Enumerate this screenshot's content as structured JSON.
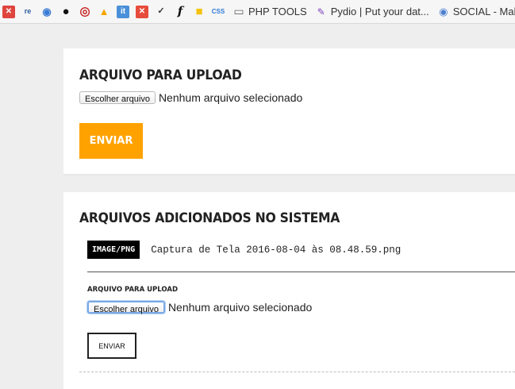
{
  "bookmarks": {
    "icons": [
      {
        "name": "red-checker-icon",
        "glyph": "✕",
        "color": "#e0443e"
      },
      {
        "name": "regex101-icon",
        "glyph": "re",
        "color": "#2b5c9e"
      },
      {
        "name": "database-icon",
        "glyph": "◉",
        "color": "#3a7bd5"
      },
      {
        "name": "github-icon",
        "glyph": "●",
        "color": "#111111"
      },
      {
        "name": "opera-icon",
        "glyph": "◎",
        "color": "#c62828"
      },
      {
        "name": "firebase-icon",
        "glyph": "▲",
        "color": "#f6a500"
      },
      {
        "name": "it-icon",
        "glyph": "it",
        "color": "#4a90d9"
      },
      {
        "name": "laravel-icon",
        "glyph": "✕",
        "color": "#e74c3c"
      },
      {
        "name": "json-icon",
        "glyph": "✓",
        "color": "#333333"
      },
      {
        "name": "function-icon",
        "glyph": "f",
        "color": "#111111"
      },
      {
        "name": "box-icon",
        "glyph": "■",
        "color": "#f4c20d"
      },
      {
        "name": "css-icon",
        "glyph": "CSS",
        "color": "#2d7ad6"
      }
    ],
    "items": [
      {
        "name": "folder-icon",
        "glyph": "▭",
        "label": "PHP TOOLS"
      },
      {
        "name": "pydio-icon",
        "glyph": "✎",
        "label": "Pydio | Put your dat..."
      },
      {
        "name": "social-icon",
        "glyph": "◉",
        "label": "SOCIAL - Makea"
      }
    ]
  },
  "upload": {
    "title": "ARQUIVO PARA UPLOAD",
    "file_button": "Escolher arquivo",
    "file_status": "Nenhum arquivo selecionado",
    "submit": "ENVIAR",
    "accent": "#ffa200"
  },
  "files": {
    "title": "ARQUIVOS ADICIONADOS NO SISTEMA",
    "entries": [
      {
        "mime": "IMAGE/PNG",
        "name": "Captura de Tela 2016-08-04 às 08.48.59.png",
        "upload_label": "ARQUIVO PARA UPLOAD",
        "file_button": "Escolher arquivo",
        "file_status": "Nenhum arquivo selecionado",
        "submit": "ENVIAR"
      }
    ]
  }
}
